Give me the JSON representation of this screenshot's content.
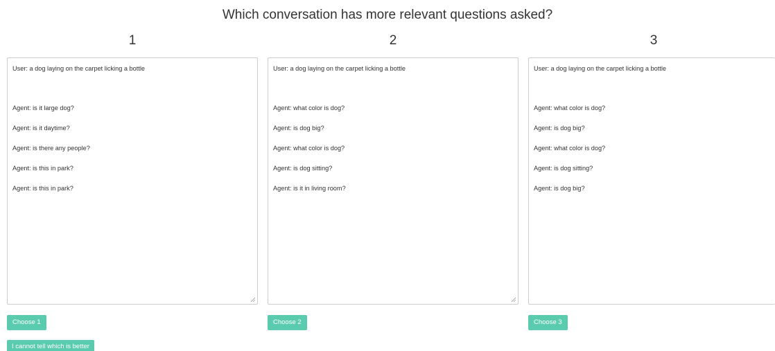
{
  "question": "Which conversation has more relevant questions asked?",
  "columns": [
    {
      "number": "1",
      "user_line": "User: a dog laying on the carpet licking a bottle",
      "agent_lines": [
        "Agent: is it large dog?",
        "Agent: is it daytime?",
        "Agent: is there any people?",
        "Agent: is this in park?",
        "Agent: is this in park?"
      ],
      "choose_label": "Choose 1"
    },
    {
      "number": "2",
      "user_line": "User: a dog laying on the carpet licking a bottle",
      "agent_lines": [
        "Agent: what color is dog?",
        "Agent: is dog big?",
        "Agent: what color is dog?",
        "Agent: is dog sitting?",
        "Agent: is it in living room?"
      ],
      "choose_label": "Choose 2"
    },
    {
      "number": "3",
      "user_line": "User: a dog laying on the carpet licking a bottle",
      "agent_lines": [
        "Agent: what color is dog?",
        "Agent: is dog big?",
        "Agent: what color is dog?",
        "Agent: is dog sitting?",
        "Agent: is dog big?"
      ],
      "choose_label": "Choose 3"
    }
  ],
  "cannot_tell_label": "I cannot tell which is better",
  "colors": {
    "button": "#5bcbb0",
    "button_text": "#ffffff",
    "border": "#cccccc",
    "text": "#333333"
  }
}
